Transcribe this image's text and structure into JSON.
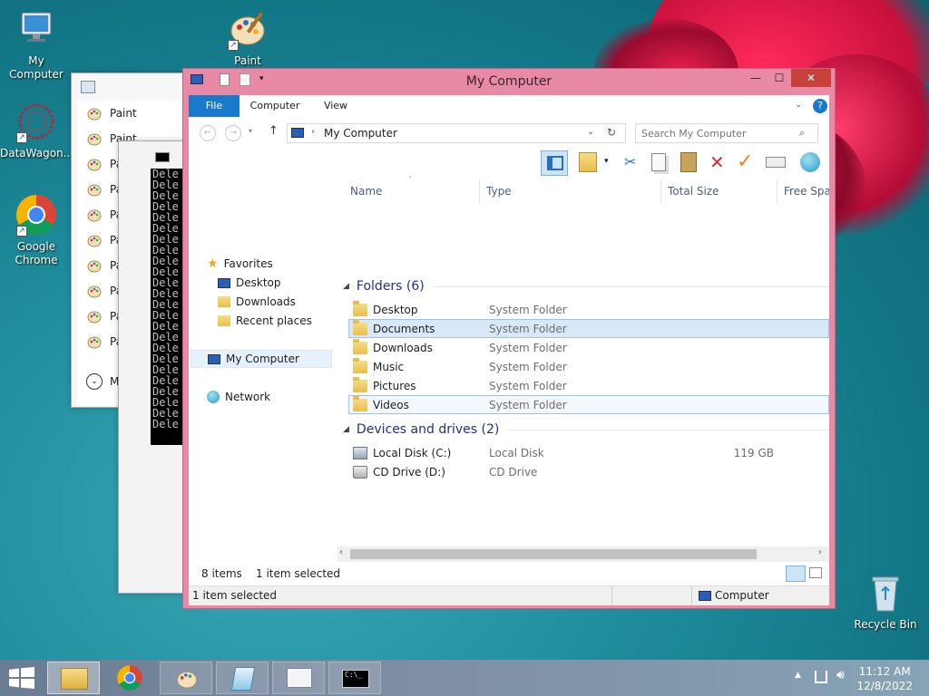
{
  "desktop": {
    "icons": [
      {
        "label": "My Computer"
      },
      {
        "label": "Paint"
      },
      {
        "label": "DataWagon..."
      },
      {
        "label": "Google Chrome"
      },
      {
        "label": "Recycle Bin"
      }
    ]
  },
  "paint_window": {
    "items": [
      "Paint",
      "Paint",
      "Paint",
      "Paint",
      "Paint",
      "Paint",
      "Paint",
      "Paint",
      "Paint",
      "Paint"
    ],
    "more_label": "More c"
  },
  "console_window": {
    "lines": [
      "Dele",
      "Dele",
      "Dele",
      "Dele",
      "Dele",
      "Dele",
      "Dele",
      "Dele",
      "Dele",
      "Dele",
      "Dele",
      "Dele",
      "Dele",
      "Dele",
      "Dele",
      "Dele",
      "Dele",
      "Dele",
      "Dele",
      "Dele",
      "Dele",
      "Dele",
      "Dele",
      "Dele"
    ]
  },
  "explorer": {
    "title": "My Computer",
    "tabs": {
      "file": "File",
      "computer": "Computer",
      "view": "View"
    },
    "address": "My Computer",
    "search_placeholder": "Search My Computer",
    "nav": {
      "favorites": "Favorites",
      "desktop": "Desktop",
      "downloads": "Downloads",
      "recent": "Recent places",
      "my_computer": "My Computer",
      "network": "Network"
    },
    "columns": {
      "name": "Name",
      "type": "Type",
      "total_size": "Total Size",
      "free_space": "Free Space"
    },
    "folders_header": "Folders (6)",
    "folders": [
      {
        "name": "Desktop",
        "type": "System Folder"
      },
      {
        "name": "Documents",
        "type": "System Folder"
      },
      {
        "name": "Downloads",
        "type": "System Folder"
      },
      {
        "name": "Music",
        "type": "System Folder"
      },
      {
        "name": "Pictures",
        "type": "System Folder"
      },
      {
        "name": "Videos",
        "type": "System Folder"
      }
    ],
    "devices_header": "Devices and drives (2)",
    "devices": [
      {
        "name": "Local Disk (C:)",
        "type": "Local Disk",
        "size": "119 GB"
      },
      {
        "name": "CD Drive (D:)",
        "type": "CD Drive",
        "size": ""
      }
    ],
    "status": {
      "items": "8 items",
      "selected": "1 item selected"
    },
    "statusbar": {
      "left": "1 item selected",
      "right": "Computer"
    }
  },
  "taskbar": {
    "clock_time": "11:12 AM",
    "clock_date": "12/8/2022"
  },
  "colors": {
    "accent": "#1979ca",
    "window_frame": "#e88aa6",
    "selection": "#d9e8f6"
  }
}
